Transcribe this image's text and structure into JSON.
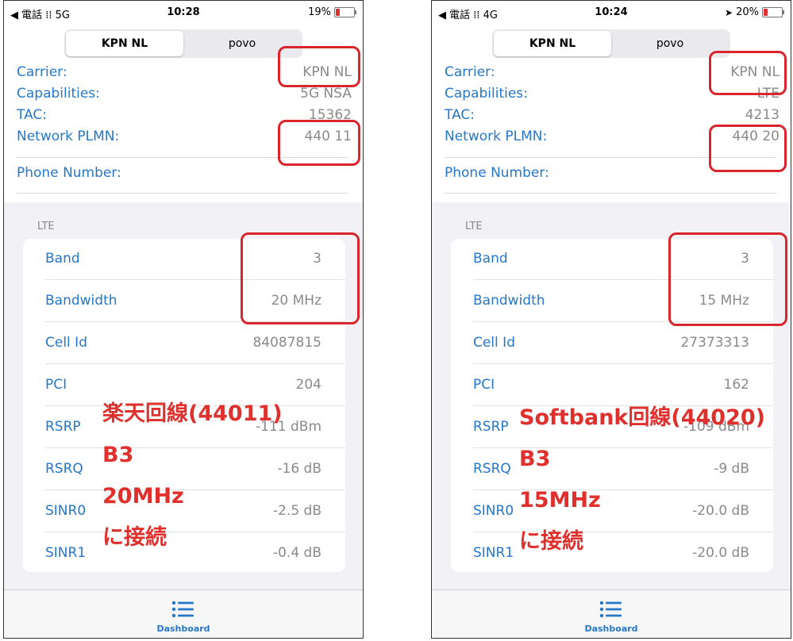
{
  "panels": [
    {
      "status": {
        "left": "◀ 電話 ⁞⁞ 5G",
        "time": "10:28",
        "battery": "19%",
        "show_location": false,
        "battery_level": 0.19
      },
      "segment": {
        "tabs": [
          "KPN NL",
          "povo"
        ],
        "active": 0
      },
      "info": {
        "carrier": {
          "label": "Carrier:",
          "value": "KPN NL"
        },
        "capabilities": {
          "label": "Capabilities:",
          "value": "5G NSA"
        },
        "tac": {
          "label": "TAC:",
          "value": "15362"
        },
        "plmn": {
          "label": "Network PLMN:",
          "value": "440 11"
        },
        "phone": {
          "label": "Phone Number:",
          "value": ""
        }
      },
      "section_label": "LTE",
      "rows": [
        {
          "label": "Band",
          "value": "3"
        },
        {
          "label": "Bandwidth",
          "value": "20 MHz"
        },
        {
          "label": "Cell Id",
          "value": "84087815"
        },
        {
          "label": "PCI",
          "value": "204"
        },
        {
          "label": "RSRP",
          "value": "-111 dBm"
        },
        {
          "label": "RSRQ",
          "value": "-16 dB"
        },
        {
          "label": "SINR0",
          "value": "-2.5 dB"
        },
        {
          "label": "SINR1",
          "value": "-0.4 dB"
        }
      ],
      "tabbar": {
        "label": "Dashboard",
        "icon": "list-icon"
      },
      "annotation": [
        "楽天回線(44011)",
        "B3",
        "20MHz",
        "に接続"
      ]
    },
    {
      "status": {
        "left": "◀ 電話 ⁞⁞ 4G",
        "time": "10:24",
        "battery": "20%",
        "show_location": true,
        "battery_level": 0.2
      },
      "segment": {
        "tabs": [
          "KPN NL",
          "povo"
        ],
        "active": 0
      },
      "info": {
        "carrier": {
          "label": "Carrier:",
          "value": "KPN NL"
        },
        "capabilities": {
          "label": "Capabilities:",
          "value": "LTE"
        },
        "tac": {
          "label": "TAC:",
          "value": "4213"
        },
        "plmn": {
          "label": "Network PLMN:",
          "value": "440 20"
        },
        "phone": {
          "label": "Phone Number:",
          "value": ""
        }
      },
      "section_label": "LTE",
      "rows": [
        {
          "label": "Band",
          "value": "3"
        },
        {
          "label": "Bandwidth",
          "value": "15 MHz"
        },
        {
          "label": "Cell Id",
          "value": "27373313"
        },
        {
          "label": "PCI",
          "value": "162"
        },
        {
          "label": "RSRP",
          "value": "-109 dBm"
        },
        {
          "label": "RSRQ",
          "value": "-9 dB"
        },
        {
          "label": "SINR0",
          "value": "-20.0 dB"
        },
        {
          "label": "SINR1",
          "value": "-20.0 dB"
        }
      ],
      "tabbar": {
        "label": "Dashboard",
        "icon": "list-icon"
      },
      "annotation": [
        "Softbank回線(44020)",
        "B3",
        "15MHz",
        "に接続"
      ]
    }
  ],
  "colors": {
    "link": "#2677c9",
    "value": "#8a8a8a",
    "annotation": "#e0302d",
    "box": "#d8262c"
  }
}
